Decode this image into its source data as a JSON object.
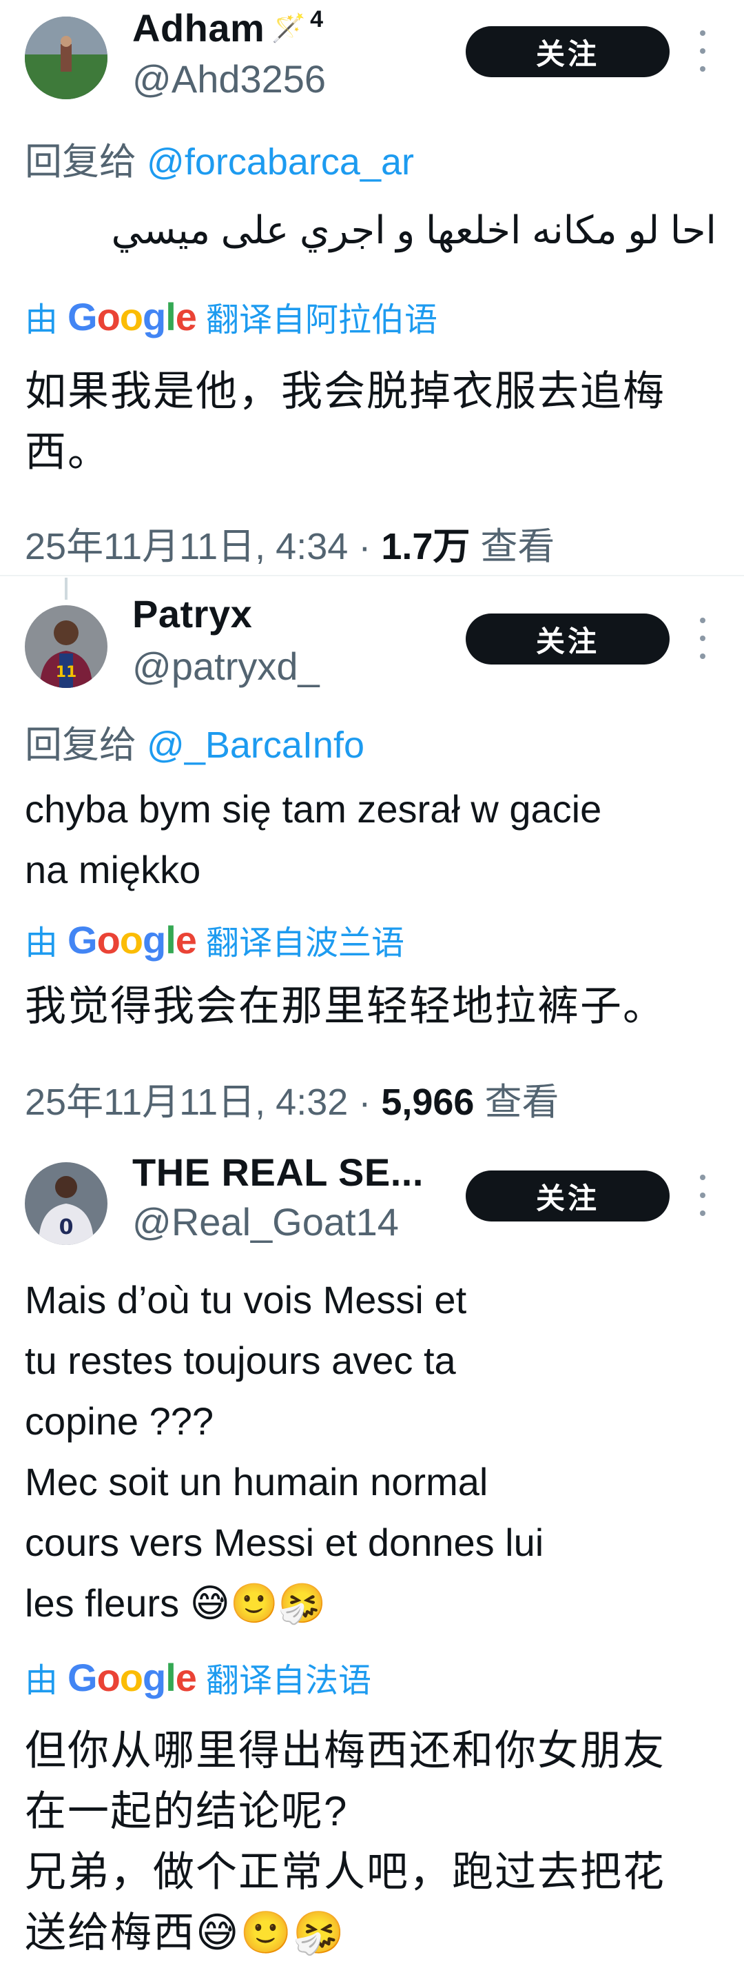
{
  "colors": {
    "text": "#0f1419",
    "muted": "#536471",
    "link": "#1d9bf0",
    "follow_bg": "#0f1419"
  },
  "posts": [
    {
      "name": "Adham",
      "badge_icon": "magic-wand-emoji",
      "badge_icon_glyph": "🪄",
      "badge_count": "4",
      "handle": "@Ahd3256",
      "follow_label": "关注",
      "reply_prefix": "回复给",
      "reply_mention": "@forcabarca_ar",
      "text": "احا لو مكانه اخلعها و اجري على ميسي",
      "translate_prefix": "由",
      "translate_suffix": "翻译自阿拉伯语",
      "translated_text": "如果我是他，我会脱掉衣服去追梅西。",
      "date": "25年11月11日, 4:34",
      "views_count": "1.7万",
      "views_label": "查看"
    },
    {
      "name": "Patryx",
      "handle": "@patryxd_",
      "follow_label": "关注",
      "reply_prefix": "回复给",
      "reply_mention": "@_BarcaInfo",
      "text": "chyba bym się tam zesrał w gacie na miękko",
      "translate_prefix": "由",
      "translate_suffix": "翻译自波兰语",
      "translated_text": "我觉得我会在那里轻轻地拉裤子。",
      "date": "25年11月11日, 4:32",
      "views_count": "5,966",
      "views_label": "查看"
    },
    {
      "name": "THE REAL SE...",
      "handle": "@Real_Goat14",
      "follow_label": "关注",
      "text": "Mais d’où tu vois Messi et\ntu restes toujours avec ta\ncopine ???\nMec soit un humain normal\ncours vers Messi et donnes lui\nles fleurs 😅🙂🤧",
      "translate_prefix": "由",
      "translate_suffix": "翻译自法语",
      "translated_text": "但你从哪里得出梅西还和你女朋友\n在一起的结论呢?\n兄弟，做个正常人吧，跑过去把花\n送给梅西😅🙂🤧"
    }
  ],
  "google_logo": [
    "G",
    "o",
    "o",
    "g",
    "l",
    "e"
  ]
}
